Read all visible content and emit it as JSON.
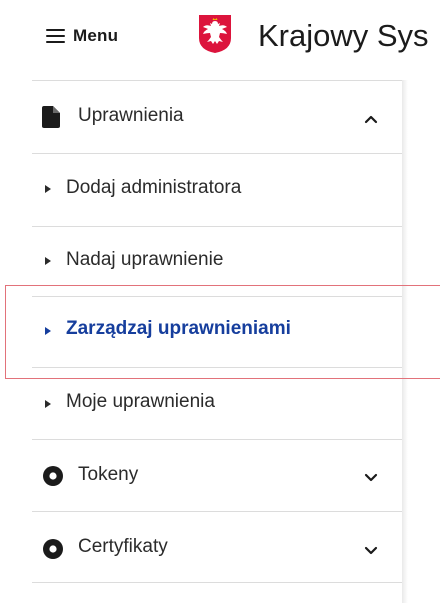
{
  "header": {
    "menu_label": "Menu",
    "app_title": "Krajowy Sys",
    "emblem_icon": "polish-eagle-emblem-icon",
    "colors": {
      "emblem_red": "#dc143c"
    }
  },
  "sidebar": {
    "sections": [
      {
        "label": "Uprawnienia",
        "icon": "document-icon",
        "expanded": true,
        "chevron": "chevron-up-icon",
        "items": [
          {
            "label": "Dodaj administratora",
            "active": false
          },
          {
            "label": "Nadaj uprawnienie",
            "active": false
          },
          {
            "label": "Zarządzaj uprawnieniami",
            "active": true
          },
          {
            "label": "Moje uprawnienia",
            "active": false
          }
        ]
      },
      {
        "label": "Tokeny",
        "icon": "circle-dot-icon",
        "expanded": false,
        "chevron": "chevron-down-icon"
      },
      {
        "label": "Certyfikaty",
        "icon": "circle-dot-icon",
        "expanded": false,
        "chevron": "chevron-down-icon"
      }
    ],
    "colors": {
      "active_text": "#163e9d",
      "highlight_border": "#e2727a",
      "divider": "#dcdcdc"
    }
  }
}
